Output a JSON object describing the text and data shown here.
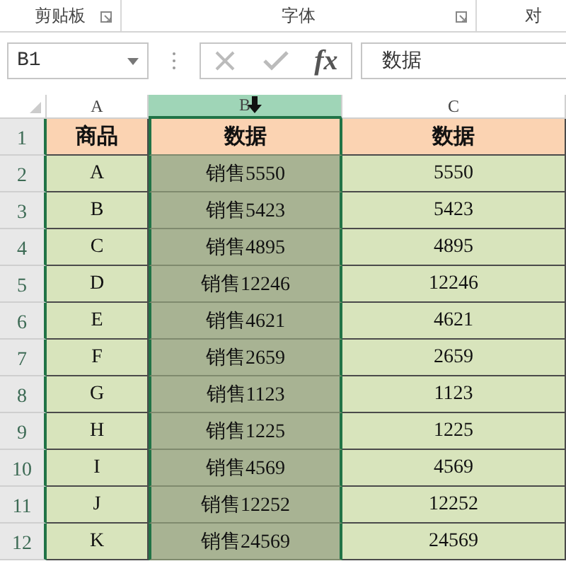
{
  "ribbon": {
    "groups": [
      {
        "label": "剪贴板",
        "launcher": true
      },
      {
        "label": "字体",
        "launcher": true
      },
      {
        "label": "对",
        "launcher": false
      }
    ]
  },
  "formula_bar": {
    "name_box": "B1",
    "fx": "fx",
    "value": "数据"
  },
  "columns": [
    {
      "label": "A",
      "selected": false
    },
    {
      "label": "B",
      "selected": true
    },
    {
      "label": "C",
      "selected": false
    }
  ],
  "rows": [
    {
      "number": "1",
      "header": true,
      "cells": [
        "商品",
        "数据",
        "数据"
      ]
    },
    {
      "number": "2",
      "header": false,
      "cells": [
        "A",
        "销售5550",
        "5550"
      ]
    },
    {
      "number": "3",
      "header": false,
      "cells": [
        "B",
        "销售5423",
        "5423"
      ]
    },
    {
      "number": "4",
      "header": false,
      "cells": [
        "C",
        "销售4895",
        "4895"
      ]
    },
    {
      "number": "5",
      "header": false,
      "cells": [
        "D",
        "销售12246",
        "12246"
      ]
    },
    {
      "number": "6",
      "header": false,
      "cells": [
        "E",
        "销售4621",
        "4621"
      ]
    },
    {
      "number": "7",
      "header": false,
      "cells": [
        "F",
        "销售2659",
        "2659"
      ]
    },
    {
      "number": "8",
      "header": false,
      "cells": [
        "G",
        "销售1123",
        "1123"
      ]
    },
    {
      "number": "9",
      "header": false,
      "cells": [
        "H",
        "销售1225",
        "1225"
      ]
    },
    {
      "number": "10",
      "header": false,
      "cells": [
        "I",
        "销售4569",
        "4569"
      ]
    },
    {
      "number": "11",
      "header": false,
      "cells": [
        "J",
        "销售12252",
        "12252"
      ]
    },
    {
      "number": "12",
      "header": false,
      "cells": [
        "K",
        "销售24569",
        "24569"
      ]
    }
  ]
}
